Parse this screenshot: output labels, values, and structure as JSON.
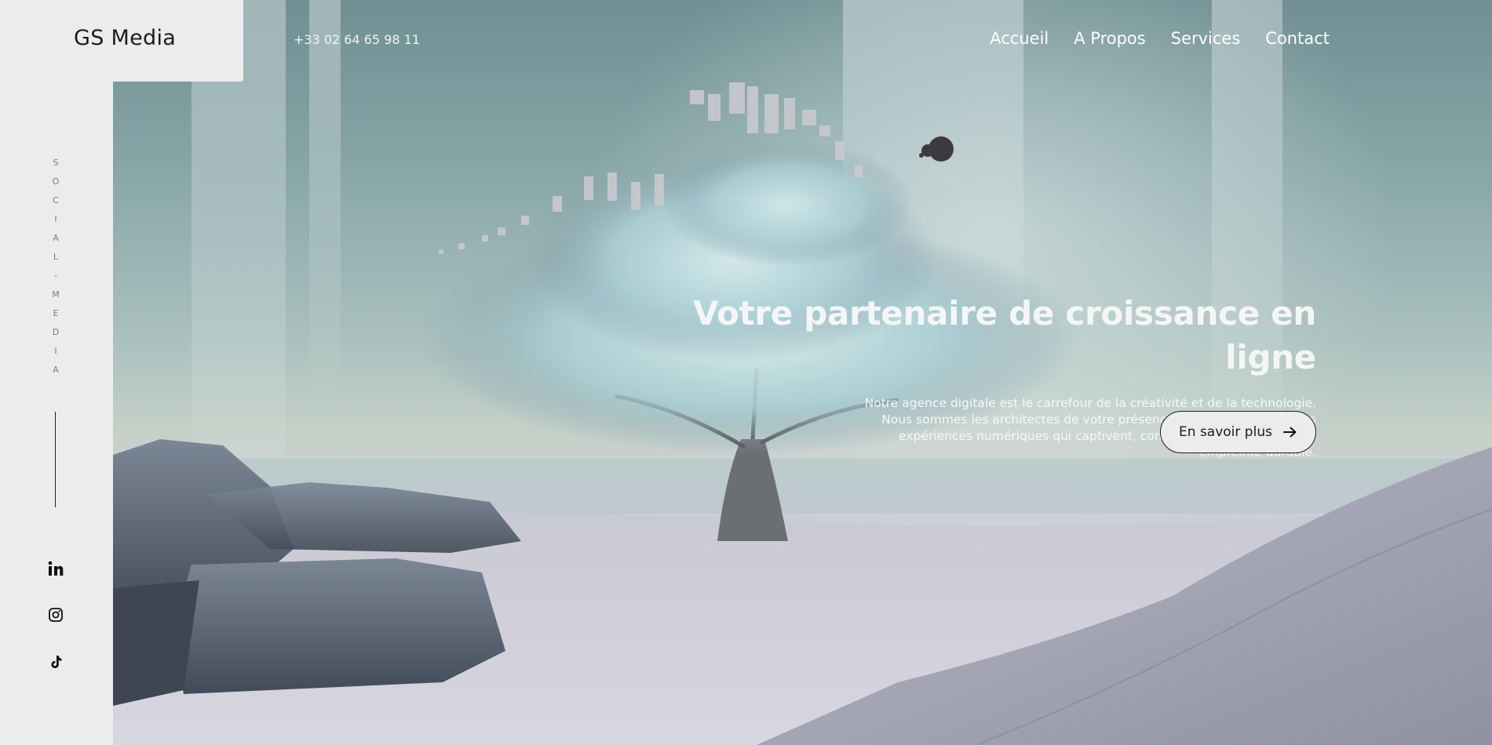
{
  "brand": {
    "logo_text": "GS Media"
  },
  "header": {
    "phone": "+33 02 64 65 98 11",
    "nav": [
      {
        "label": "Accueil"
      },
      {
        "label": "A Propos"
      },
      {
        "label": "Services"
      },
      {
        "label": "Contact"
      }
    ]
  },
  "sidebar": {
    "vertical_text": [
      "S",
      "O",
      "C",
      "I",
      "A",
      "L",
      "-",
      "M",
      "E",
      "D",
      "I",
      "A"
    ],
    "social_icons": [
      "linkedin-icon",
      "instagram-icon",
      "tiktok-icon"
    ]
  },
  "hero": {
    "title": "Votre partenaire de croissance en ligne",
    "text": "Notre agence digitale est le carrefour de la créativité et de la technologie. Nous sommes les architectes de votre présence en ligne, sculptant des expériences numériques qui captivent, convertissent et laissent une empreinte durable.",
    "cta_label": "En savoir plus",
    "cta_icon": "arrow-right-icon"
  },
  "colors": {
    "panel": "#ececec",
    "text_dark": "#1b1b1b",
    "text_light": "#ffffff"
  }
}
